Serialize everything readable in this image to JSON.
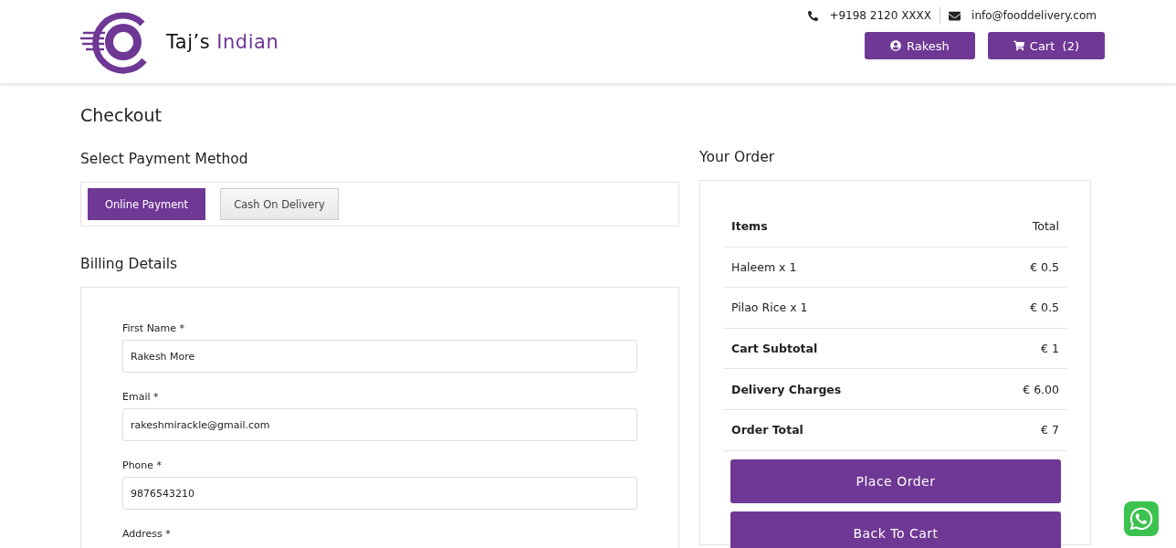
{
  "header": {
    "brand": {
      "first": "Taj’s",
      "second": "Indian"
    },
    "phone": "+9198 2120 XXXX",
    "email": "info@fooddelivery.com",
    "user_button": "Rakesh",
    "cart_button": {
      "label": "Cart",
      "count": "(2)"
    }
  },
  "page_title": "Checkout",
  "payment": {
    "title": "Select Payment Method",
    "options": [
      {
        "label": "Online Payment",
        "selected": true
      },
      {
        "label": "Cash On Delivery",
        "selected": false
      }
    ]
  },
  "billing": {
    "title": "Billing Details",
    "fields": [
      {
        "label": "First Name *",
        "value": "Rakesh More"
      },
      {
        "label": "Email *",
        "value": "rakeshmirackle@gmail.com"
      },
      {
        "label": "Phone *",
        "value": "9876543210"
      },
      {
        "label": "Address *"
      }
    ]
  },
  "order": {
    "title": "Your Order",
    "rows": [
      {
        "kind": "head",
        "label": "Items",
        "value": "Total"
      },
      {
        "kind": "item",
        "label": "Haleem x 1",
        "value": "€ 0.5"
      },
      {
        "kind": "item",
        "label": "Pilao Rice x 1",
        "value": "€ 0.5"
      },
      {
        "kind": "summary",
        "label": "Cart Subtotal",
        "value": "€ 1"
      },
      {
        "kind": "summary",
        "label": "Delivery Charges",
        "value": "€ 6.00"
      },
      {
        "kind": "summary",
        "label": "Order Total",
        "value": "€ 7"
      }
    ],
    "buttons": [
      "Place Order",
      "Back To Cart"
    ]
  }
}
